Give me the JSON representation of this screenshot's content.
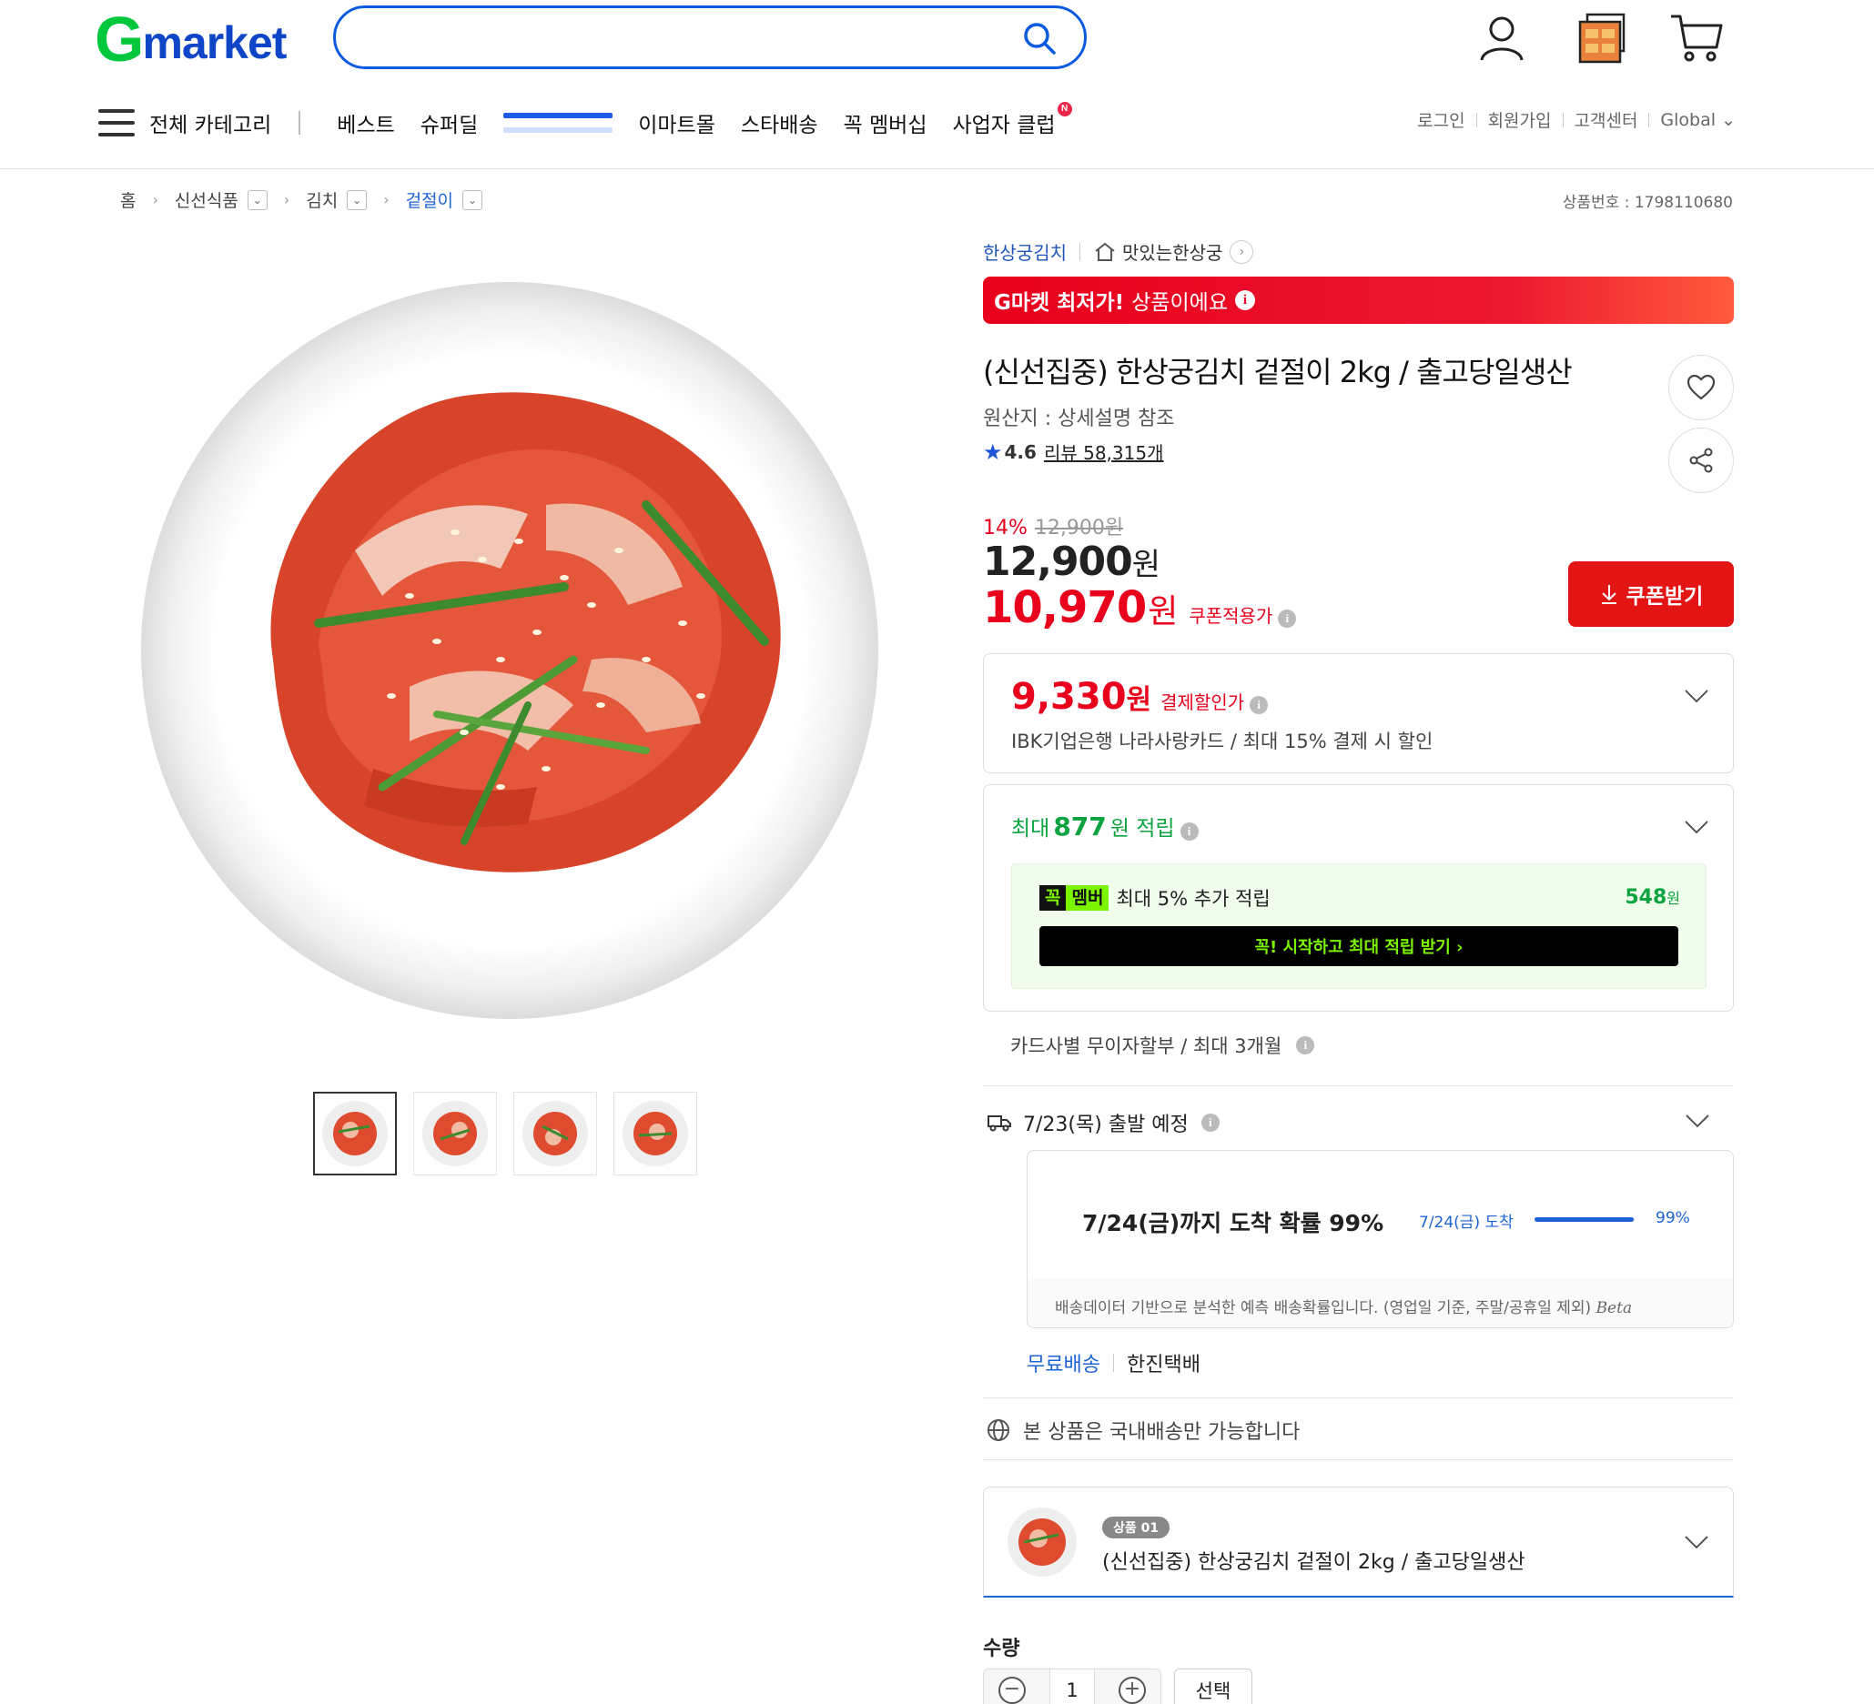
{
  "header": {
    "logo_g": "G",
    "logo_rest": "market",
    "search": {
      "value": "",
      "placeholder": ""
    },
    "icons": [
      "user-icon",
      "recent-items-icon",
      "cart-icon"
    ]
  },
  "nav": {
    "all_categories": "전체 카테고리",
    "items": [
      "베스트",
      "슈퍼딜",
      "",
      "이마트몰",
      "스타배송",
      "꼭 멤버십",
      "사업자 클럽"
    ],
    "new_badge": "N"
  },
  "util_links": [
    "로그인",
    "회원가입",
    "고객센터",
    "Global ⌄"
  ],
  "breadcrumb": [
    "홈",
    "신선식품",
    "김치",
    "겉절이"
  ],
  "product_number": "상품번호 : 1798110680",
  "seller": {
    "brand": "한상궁김치",
    "shop": "맛있는한상궁"
  },
  "banner": {
    "bold": "G마켓 최저가!",
    "text": "상품이에요"
  },
  "product": {
    "title": "(신선집중) 한상궁김치 겉절이 2kg / 출고당일생산",
    "origin": "원산지 : 상세설명 참조",
    "rating": "4.6",
    "review": "리뷰 58,315개"
  },
  "price": {
    "discount_pct": "14%",
    "original": "12,900원",
    "sale_num": "12,900",
    "sale_won": "원",
    "coupon_num": "10,970",
    "coupon_won": "원",
    "coupon_label": "쿠폰적용가",
    "coupon_button": "쿠폰받기"
  },
  "payment": {
    "num": "9,330",
    "won": "원",
    "label": "결제할인가",
    "desc": "IBK기업은행 나라사랑카드 / 최대 15% 결제 시 할인"
  },
  "points": {
    "prefix": "최대",
    "amount": "877",
    "suffix": "원 적립",
    "member_badge_a": "꼭",
    "member_badge_b": "멤버",
    "member_text": "최대 5% 추가 적립",
    "member_amount": "548",
    "member_won": "원",
    "member_cta": "꼭! 시작하고 최대 적립 받기  ›"
  },
  "installment": "카드사별 무이자할부 / 최대 3개월",
  "shipping": {
    "depart": "7/23(목) 출발 예정",
    "arrive_main": "7/24(금)까지 도착 확률 99%",
    "arrive_date": "7/24(금) 도착",
    "probability": 0.99,
    "probability_label": "99%",
    "note": "배송데이터 기반으로 분석한 예측 배송확률입니다. (영업일 기준, 주말/공휴일 제외)",
    "beta": "Beta",
    "free": "무료배송",
    "courier": "한진택배",
    "domestic": "본 상품은 국내배송만 가능합니다"
  },
  "option": {
    "badge": "상품 01",
    "name": "(신선집중) 한상궁김치 겉절이 2kg / 출고당일생산"
  },
  "quantity": {
    "label": "수량",
    "value": "1",
    "minus": "−",
    "plus": "+",
    "select": "선택"
  },
  "colors": {
    "brand_green": "#00c73c",
    "brand_blue": "#0f46c8",
    "accent_red": "#e8001c",
    "point_green": "#0ca340",
    "link_blue": "#1e63d6"
  }
}
